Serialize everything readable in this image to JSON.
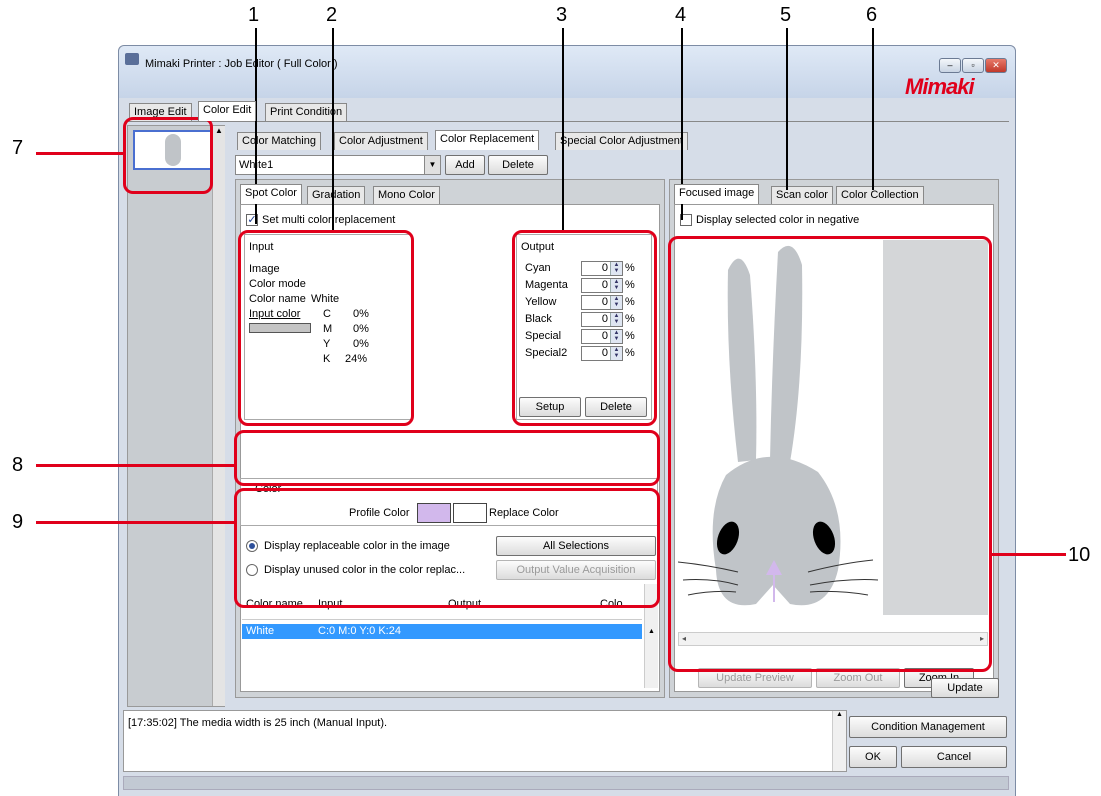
{
  "callouts": [
    "1",
    "2",
    "3",
    "4",
    "5",
    "6",
    "7",
    "8",
    "9",
    "10"
  ],
  "window": {
    "title": "Mimaki Printer : Job Editor ( Full Color )",
    "logo": "Mimaki",
    "controls": {
      "minimize": "–",
      "maximize": "▫",
      "close": "✕"
    }
  },
  "main_tabs": [
    "Image Edit",
    "Color Edit",
    "Print Condition"
  ],
  "sub_tabs": [
    "Color Matching",
    "Color Adjustment",
    "Color Replacement",
    "Special Color Adjustment"
  ],
  "toolbar": {
    "selected_set": "White1",
    "add": "Add",
    "delete": "Delete"
  },
  "inner_tabs": [
    "Spot Color",
    "Gradation",
    "Mono Color"
  ],
  "multi_replace": {
    "label": "Set multi color replacement",
    "checked": true
  },
  "input_group": {
    "title": "Input",
    "image_label": "Image",
    "mode_label": "Color mode",
    "name_label": "Color name",
    "name_value": "White",
    "input_color_label": "Input color",
    "channels": [
      {
        "ch": "C",
        "val": "0%"
      },
      {
        "ch": "M",
        "val": "0%"
      },
      {
        "ch": "Y",
        "val": "0%"
      },
      {
        "ch": "K",
        "val": "24%"
      }
    ],
    "swatch_color": "#c4c4c4"
  },
  "output_group": {
    "title": "Output",
    "rows": [
      {
        "label": "Cyan",
        "value": "0",
        "unit": "%"
      },
      {
        "label": "Magenta",
        "value": "0",
        "unit": "%"
      },
      {
        "label": "Yellow",
        "value": "0",
        "unit": "%"
      },
      {
        "label": "Black",
        "value": "0",
        "unit": "%"
      },
      {
        "label": "Special",
        "value": "0",
        "unit": "%"
      },
      {
        "label": "Special2",
        "value": "0",
        "unit": "%"
      }
    ],
    "setup": "Setup",
    "delete": "Delete"
  },
  "color_group": {
    "title": "Color",
    "profile_label": "Profile Color",
    "replace_label": "Replace Color",
    "profile_color": "#d2b8ec",
    "replace_color": "#ffffff"
  },
  "display_options": {
    "opt1": "Display replaceable color in the image",
    "opt2": "Display unused color in the color replac...",
    "all_selections": "All Selections",
    "output_value": "Output Value Acquisition"
  },
  "table": {
    "headers": [
      "Color name",
      "Input",
      "Output",
      "Colo..."
    ],
    "rows": [
      {
        "name": "White",
        "input": "C:0 M:0 Y:0 K:24",
        "output": "",
        "color": ""
      }
    ]
  },
  "right_tabs": [
    "Focused image",
    "Scan color",
    "Color Collection"
  ],
  "negative": {
    "label": "Display selected color in negative",
    "checked": false
  },
  "preview_buttons": {
    "update_preview": "Update Preview",
    "zoom_out": "Zoom Out",
    "zoom_in": "Zoom In"
  },
  "update": "Update",
  "log": "[17:35:02] The media width is 25 inch (Manual Input).",
  "bottom_buttons": {
    "condition": "Condition Management",
    "ok": "OK",
    "cancel": "Cancel"
  },
  "colors": {
    "accent_red": "#e0001b",
    "selection_blue": "#3399ff",
    "rabbit_gray": "#c0c4c8"
  }
}
